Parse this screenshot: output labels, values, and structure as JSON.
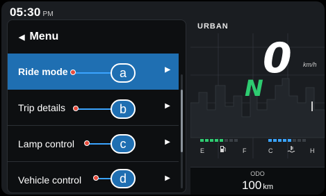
{
  "status": {
    "time": "05:30",
    "ampm": "PM"
  },
  "menu": {
    "title": "Menu",
    "items": [
      {
        "label": "Ride mode",
        "badge": "a",
        "active": true
      },
      {
        "label": "Trip details",
        "badge": "b",
        "active": false
      },
      {
        "label": "Lamp control",
        "badge": "c",
        "active": false
      },
      {
        "label": "Vehicle control",
        "badge": "d",
        "active": false
      }
    ]
  },
  "cluster": {
    "drive_mode": "URBAN",
    "speed": "0",
    "speed_unit": "km/h",
    "gear": "N",
    "fuel": {
      "label_empty": "E",
      "label_full": "F",
      "icon": "fuel-pump-icon",
      "level_segments": 5,
      "total_segments": 8
    },
    "temp": {
      "label_cold": "C",
      "label_hot": "H",
      "icon": "coolant-temp-icon",
      "level_segments": 5,
      "total_segments": 8
    }
  },
  "odo": {
    "label": "ODO",
    "value": "100",
    "unit": "km"
  },
  "colors": {
    "accent": "#1f6fb2",
    "gear": "#2ecc71",
    "fuel": "#2ecc71",
    "temp": "#3ba4ff"
  }
}
